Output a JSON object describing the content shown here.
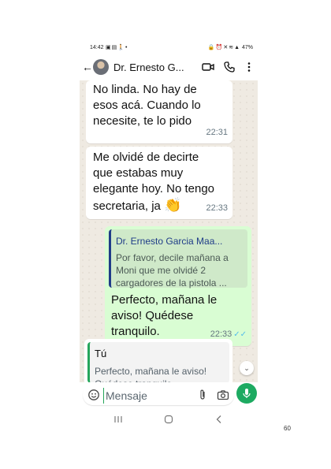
{
  "status_bar": {
    "time": "14:42",
    "left_icons": [
      "gallery-icon",
      "card-icon",
      "walk-icon",
      "dot-icon"
    ],
    "right_icons": [
      "lock-icon",
      "alarm-icon",
      "mute-icon",
      "wifi-icon",
      "signal-icon"
    ],
    "battery": "47%"
  },
  "header": {
    "contact_name": "Dr. Ernesto G...",
    "icons": [
      "back-arrow-icon",
      "video-call-icon",
      "phone-icon",
      "more-options-icon"
    ]
  },
  "messages": [
    {
      "direction": "in",
      "text": "No linda. No hay de esos acá. Cuando lo necesite, te lo pido",
      "time": "22:31"
    },
    {
      "direction": "in",
      "text": "Me olvidé de decirte que estabas muy elegante hoy. No tengo secretaria, ja",
      "emoji": "👏",
      "time": "22:33"
    },
    {
      "direction": "out",
      "quote": {
        "author": "Dr. Ernesto Garcia Maa...",
        "text": "Por favor,  decile mañana a Moni que me olvidé 2 cargadores de la pistola ..."
      },
      "text": "Perfecto, mañana le aviso! Quédese tranquilo.",
      "time": "22:33",
      "read_ticks": "✓✓"
    }
  ],
  "reply_preview": {
    "author": "Tú",
    "text": "Perfecto, mañana le aviso! Quédese tranquilo."
  },
  "input": {
    "placeholder": "Mensaje",
    "value": ""
  },
  "colors": {
    "chat_background": "#efeae2",
    "incoming_bubble": "#ffffff",
    "outgoing_bubble": "#d9fdd3",
    "accent_green": "#1daa61",
    "quote_author": "#1f3c88",
    "read_ticks": "#53bdeb"
  },
  "nav_bar": [
    "recents-icon",
    "home-icon",
    "back-nav-icon"
  ],
  "page_number": "60"
}
